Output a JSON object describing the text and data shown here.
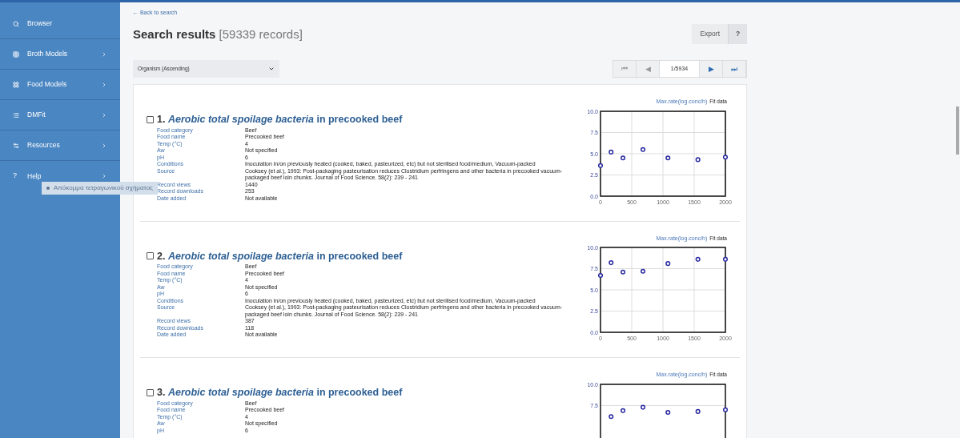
{
  "sidebar": {
    "items": [
      {
        "label": "Browser",
        "expandable": false
      },
      {
        "label": "Broth Models",
        "expandable": true
      },
      {
        "label": "Food Models",
        "expandable": true
      },
      {
        "label": "DMFit",
        "expandable": true
      },
      {
        "label": "Resources",
        "expandable": true
      },
      {
        "label": "Help",
        "expandable": true,
        "glyph": "?"
      }
    ]
  },
  "tooltip": {
    "text": "Απόκομμα τετραγωνικού σχήματος"
  },
  "back_link": "← Back to search",
  "heading": {
    "title": "Search results",
    "count": "[59339 records]"
  },
  "toolbar": {
    "buttons": [
      "Export",
      "?"
    ]
  },
  "sort": {
    "value": "Organism (Ascending)"
  },
  "pager": {
    "first": {
      "label": "⏮",
      "disabled": true
    },
    "prev": {
      "label": "◀",
      "disabled": true
    },
    "page": "1/5934",
    "next": {
      "label": "▶",
      "disabled": false
    },
    "last": {
      "label": "⏭",
      "disabled": false
    }
  },
  "records": [
    {
      "checked": false,
      "number": "1.",
      "organism": "Aerobic total spoilage bacteria",
      "suffix": "in precooked beef",
      "fields": [
        {
          "label": "Food category",
          "value": "Beef"
        },
        {
          "label": "Food name",
          "value": "Precooked beef"
        },
        {
          "label": "Temp (°C)",
          "value": "4"
        },
        {
          "label": "Aw",
          "value": "Not specified"
        },
        {
          "label": "pH",
          "value": "6"
        },
        {
          "label": "Conditions",
          "value": "Inoculation in/on previously heated (cooked, baked, pasteurized, etc) but not sterilised food/medium, Vacuum-packed"
        },
        {
          "label": "Source",
          "value": "Cooksey (et al.), 1993: Post-packaging pasteurisation reduces Clostridium perfringens and other bacteria in precooked vacuum-packaged beef loin chunks. Journal of Food Science. 58(2): 239 - 241"
        },
        {
          "label": "Record views",
          "value": "1440"
        },
        {
          "label": "Record downloads",
          "value": "253"
        },
        {
          "label": "Date added",
          "value": "Not available"
        }
      ],
      "chart_link": "Max.rate(log.conc/h)",
      "chart_note": "Fit data",
      "chart_data": {
        "type": "scatter",
        "grid": true,
        "x": [
          0,
          170,
          360,
          680,
          1080,
          1560,
          2000
        ],
        "series": [
          {
            "color": "#2a2aa0",
            "values": [
              3.6,
              5.2,
              4.5,
              5.5,
              4.5,
              4.3,
              4.6
            ]
          }
        ],
        "xlim": [
          0,
          2000
        ],
        "ylim": [
          0,
          10
        ],
        "xticks": [
          0,
          500,
          1000,
          1500,
          2000
        ],
        "yticks": [
          {
            "value": 0,
            "label": "0.0"
          },
          {
            "value": 2.5,
            "label": "2.5"
          },
          {
            "value": 5,
            "label": "5.0"
          },
          {
            "value": 7.5,
            "label": "7.5"
          },
          {
            "value": 10,
            "label": "10.0"
          }
        ]
      }
    },
    {
      "checked": false,
      "number": "2.",
      "organism": "Aerobic total spoilage bacteria",
      "suffix": "in precooked beef",
      "fields": [
        {
          "label": "Food category",
          "value": "Beef"
        },
        {
          "label": "Food name",
          "value": "Precooked beef"
        },
        {
          "label": "Temp (°C)",
          "value": "4"
        },
        {
          "label": "Aw",
          "value": "Not specified"
        },
        {
          "label": "pH",
          "value": "6"
        },
        {
          "label": "Conditions",
          "value": "Inoculation in/on previously heated (cooked, baked, pasteurized, etc) but not sterilised food/medium, Vacuum-packed"
        },
        {
          "label": "Source",
          "value": "Cooksey (et al.), 1993: Post-packaging pasteurisation reduces Clostridium perfringens and other bacteria in precooked vacuum-packaged beef loin chunks. Journal of Food Science. 58(2): 239 - 241"
        },
        {
          "label": "Record views",
          "value": "387"
        },
        {
          "label": "Record downloads",
          "value": "118"
        },
        {
          "label": "Date added",
          "value": "Not available"
        }
      ],
      "chart_link": "Max.rate(log.conc/h)",
      "chart_note": "Fit data",
      "chart_data": {
        "type": "scatter",
        "grid": true,
        "x": [
          0,
          170,
          360,
          680,
          1080,
          1560,
          2000
        ],
        "series": [
          {
            "color": "#2a2aa0",
            "values": [
              6.7,
              8.2,
              7.1,
              7.2,
              8.1,
              8.6,
              8.6
            ]
          }
        ],
        "xlim": [
          0,
          2000
        ],
        "ylim": [
          0,
          10
        ],
        "xticks": [
          0,
          500,
          1000,
          1500,
          2000
        ],
        "yticks": [
          {
            "value": 0,
            "label": "0.0"
          },
          {
            "value": 2.5,
            "label": "2.5"
          },
          {
            "value": 5,
            "label": "5.0"
          },
          {
            "value": 7.5,
            "label": "7.5"
          },
          {
            "value": 10,
            "label": "10.0"
          }
        ]
      }
    },
    {
      "checked": false,
      "number": "3.",
      "organism": "Aerobic total spoilage bacteria",
      "suffix": "in precooked beef",
      "fields": [
        {
          "label": "Food category",
          "value": "Beef"
        },
        {
          "label": "Food name",
          "value": "Precooked beef"
        },
        {
          "label": "Temp (°C)",
          "value": "4"
        },
        {
          "label": "Aw",
          "value": "Not specified"
        },
        {
          "label": "pH",
          "value": "6"
        }
      ],
      "chart_link": "Max.rate(log.conc/h)",
      "chart_note": "Fit data",
      "chart_data": {
        "type": "scatter",
        "grid": true,
        "x": [
          170,
          360,
          680,
          1080,
          1560,
          2000
        ],
        "series": [
          {
            "color": "#2a2aa0",
            "values": [
              6.2,
              6.9,
              7.3,
              6.7,
              6.8,
              7.0
            ]
          }
        ],
        "xlim": [
          0,
          2000
        ],
        "ylim": [
          0,
          10
        ],
        "yticks": [
          {
            "value": 7.5,
            "label": "7.5"
          },
          {
            "value": 10,
            "label": "10.0"
          }
        ]
      }
    }
  ]
}
